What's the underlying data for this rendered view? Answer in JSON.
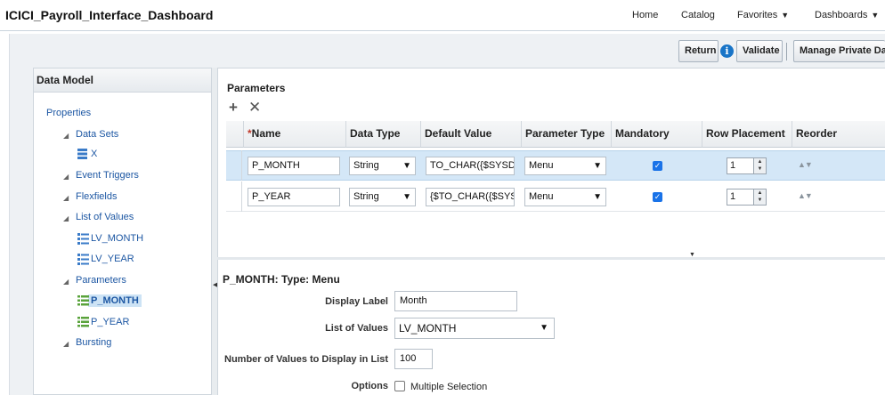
{
  "app": {
    "title": "ICICI_Payroll_Interface_Dashboard"
  },
  "nav": {
    "home": "Home",
    "catalog": "Catalog",
    "favorites": "Favorites",
    "dashboards": "Dashboards"
  },
  "toolbar": {
    "return_label": "Return",
    "validate_label": "Validate",
    "manage_private_label": "Manage Private Dat"
  },
  "data_model": {
    "title": "Data Model",
    "tree": {
      "properties": "Properties",
      "data_sets": "Data Sets",
      "data_set_x": "X",
      "event_triggers": "Event Triggers",
      "flexfields": "Flexfields",
      "list_of_values": "List of Values",
      "lov_month": "LV_MONTH",
      "lov_year": "LV_YEAR",
      "parameters": "Parameters",
      "param_month": "P_MONTH",
      "param_year": "P_YEAR",
      "bursting": "Bursting"
    }
  },
  "parameters": {
    "title": "Parameters",
    "columns": {
      "name_required": "*",
      "name": "Name",
      "data_type": "Data Type",
      "default_value": "Default Value",
      "parameter_type": "Parameter Type",
      "mandatory": "Mandatory",
      "row_placement": "Row Placement",
      "reorder": "Reorder"
    },
    "rows": [
      {
        "name": "P_MONTH",
        "data_type": "String",
        "default_value": "TO_CHAR({$SYSD",
        "parameter_type": "Menu",
        "mandatory": true,
        "row_placement": "1"
      },
      {
        "name": "P_YEAR",
        "data_type": "String",
        "default_value": "{$TO_CHAR({$SYSD",
        "parameter_type": "Menu",
        "mandatory": true,
        "row_placement": "1"
      }
    ]
  },
  "detail": {
    "title": "P_MONTH: Type: Menu",
    "display_label_label": "Display Label",
    "display_label_value": "Month",
    "list_of_values_label": "List of Values",
    "list_of_values_value": "LV_MONTH",
    "num_values_label": "Number of Values to Display in List",
    "num_values_value": "100",
    "options_label": "Options",
    "multiple_selection_label": "Multiple Selection",
    "multiple_selection": false
  },
  "colors": {
    "selected_row": "#d4e7f7",
    "link": "#1d57a3",
    "info_icon": "#1874c7",
    "checkbox": "#1a73e8"
  }
}
